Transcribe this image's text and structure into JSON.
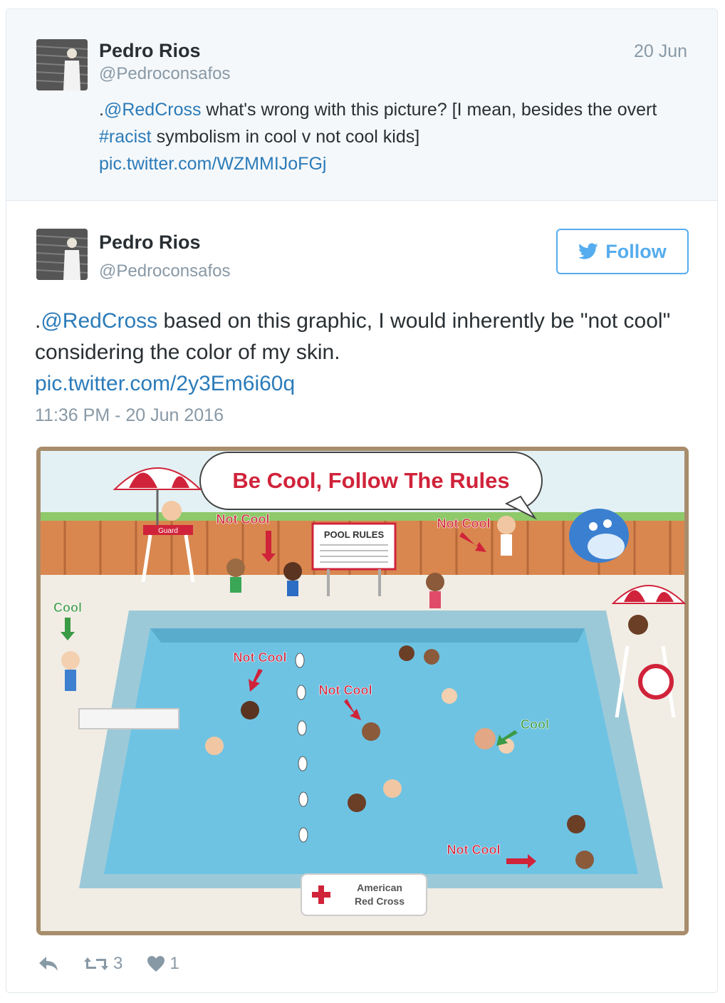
{
  "parent_tweet": {
    "author_name": "Pedro Rios",
    "handle": "@Pedroconsafos",
    "date": "20 Jun",
    "text_prefix": ".",
    "mention": "@RedCross",
    "text_middle": " what's wrong with this picture? [I mean, besides the overt ",
    "hashtag": "#racist",
    "text_end": " symbolism in cool v not cool kids]",
    "pic_link": "pic.twitter.com/WZMMIJoFGj"
  },
  "main_tweet": {
    "author_name": "Pedro Rios",
    "handle": "@Pedroconsafos",
    "follow_label": "Follow",
    "text_prefix": ".",
    "mention": "@RedCross",
    "text_rest": " based on this graphic, I would inherently be \"not cool\" considering the color of my skin.",
    "pic_link": "pic.twitter.com/2y3Em6i60q",
    "timestamp": "11:36 PM - 20 Jun 2016"
  },
  "poster": {
    "headline": "Be Cool, Follow The Rules",
    "sign_title": "POOL RULES",
    "guard_label": "Guard",
    "logo_line1": "American",
    "logo_line2": "Red Cross",
    "labels": {
      "not_cool_1": "Not Cool",
      "not_cool_2": "Not Cool",
      "not_cool_3": "Not Cool",
      "not_cool_4": "Not Cool",
      "not_cool_5": "Not Cool",
      "cool_1": "Cool",
      "cool_2": "Cool"
    }
  },
  "actions": {
    "reply_icon": "reply-icon",
    "retweet_icon": "retweet-icon",
    "retweet_count": "3",
    "like_icon": "heart-icon",
    "like_count": "1"
  },
  "colors": {
    "link": "#2b7bb9",
    "follow_blue": "#55acee",
    "muted": "#8899a6",
    "text": "#292f33",
    "parent_bg": "#f5f8fa",
    "poster_red": "#d0233a",
    "pool_blue": "#6ec3e3"
  }
}
